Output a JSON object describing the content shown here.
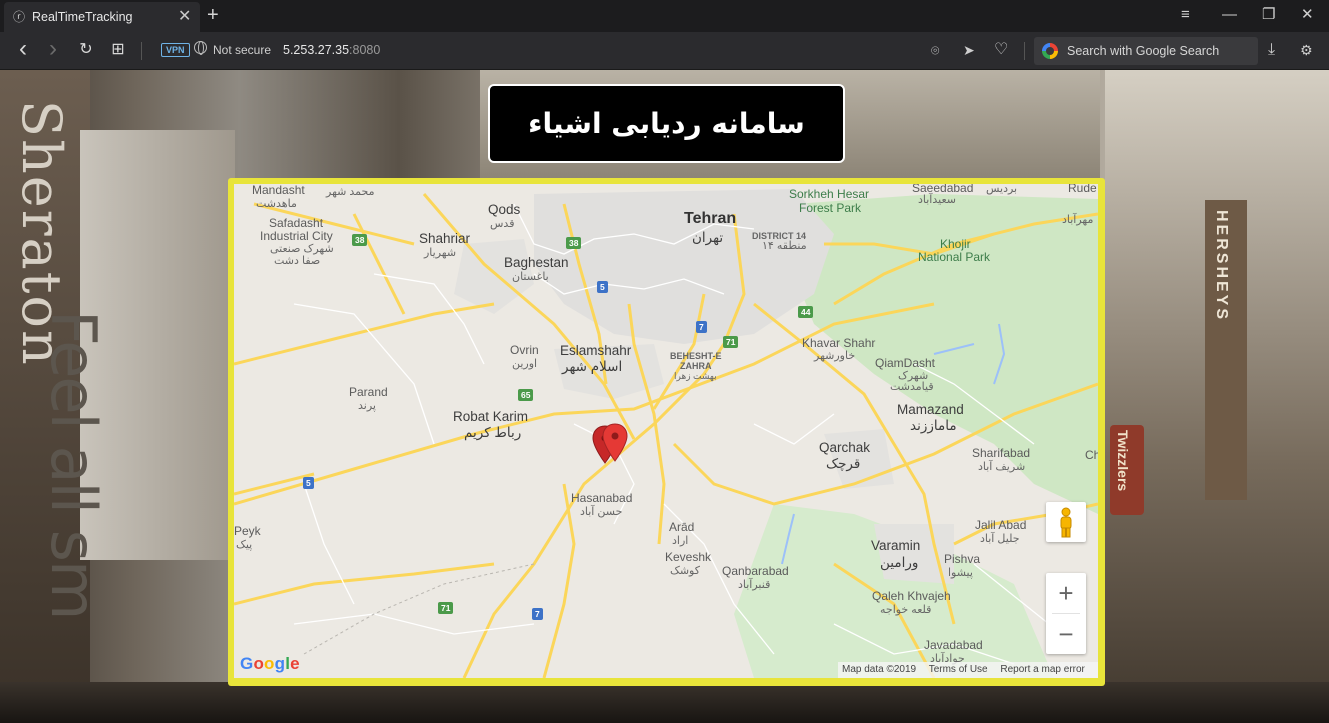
{
  "browser": {
    "tab_title": "RealTimeTracking",
    "tab_close": "✕",
    "new_tab": "+",
    "back_icon": "‹",
    "forward_icon": "›",
    "reload_icon": "↻",
    "grid_icon": "⊞",
    "vpn_label": "VPN",
    "security_label": "Not secure",
    "url_host": "5.253.27.35",
    "url_port": ":8080",
    "search_placeholder": "Search with Google Search",
    "window": {
      "menu": "≡",
      "minimize": "—",
      "restore": "❐",
      "close": "✕"
    },
    "tools": {
      "camera": "⌾",
      "send": "➤",
      "heart": "♡",
      "download": "⤓",
      "settings": "⚙"
    }
  },
  "page": {
    "title": "سامانه ردیابی اشیاء",
    "background_text": {
      "sheraton": "Sheraton",
      "truck": "Feel all sm",
      "hersheys": "HERSHEYS",
      "twizzlers": "Twizzlers"
    }
  },
  "map": {
    "labels": {
      "mandasht": "Mandasht",
      "mandasht_fa": "ماهدشت",
      "mohammadshahr_fa": "محمد شهر",
      "safadasht": "Safadasht",
      "industrial_city": "Industrial City",
      "safadasht_fa1": "شهرک صنعتی",
      "safadasht_fa2": "صفا دشت",
      "qods": "Qods",
      "qods_fa": "قدس",
      "shahriar": "Shahriar",
      "shahriar_fa": "شهریار",
      "baghestan": "Baghestan",
      "baghestan_fa": "باغستان",
      "tehran": "Tehran",
      "tehran_fa": "تهران",
      "district14": "DISTRICT 14",
      "district14_fa": "منطقه ۱۴",
      "sorkheh_hesar": "Sorkheh Hesar",
      "forest_park": "Forest Park",
      "saeedabad": "Saeedabad",
      "saeedabad_fa": "سعیدآباد",
      "bardis_fa": "بردیس",
      "rude": "Rude",
      "mehrabad_fa": "مهرآباد",
      "khojir": "Khojir",
      "national_park": "National Park",
      "ovrin": "Ovrin",
      "ovrin_fa": "اورین",
      "eslamshahr": "Eslamshahr",
      "eslamshahr_fa": "اسلام شهر",
      "beheshte_zahra": "BEHESHT-E",
      "beheshte_zahra2": "ZAHRA",
      "beheshte_zahra_fa": "بهشت زهرا",
      "khavar_shahr": "Khavar Shahr",
      "khavar_shahr_fa": "خاورشهر",
      "qiamdasht": "QiamDasht",
      "qiamdasht_fa1": "شهرک",
      "qiamdasht_fa2": "قیامدشت",
      "parand": "Parand",
      "parand_fa": "پرند",
      "robat_karim": "Robat Karim",
      "robat_karim_fa": "رباط کریم",
      "mamazand": "Mamazand",
      "mamazand_fa": "ماماززند",
      "qarchak": "Qarchak",
      "qarchak_fa": "قرچک",
      "sharifabad": "Sharifabad",
      "sharifabad_fa": "شریف آباد",
      "ch": "Ch",
      "hasanabad": "Hasanabad",
      "hasanabad_fa": "حسن آباد",
      "arad": "Arād",
      "arad_fa": "اراد",
      "keveshk": "Keveshk",
      "keveshk_fa": "کوشک",
      "peyk": "Peyk",
      "peyk_fa": "پیک",
      "jalil_abad": "Jalil Abad",
      "jalil_abad_fa": "جلیل آباد",
      "varamin": "Varamin",
      "varamin_fa": "ورامین",
      "qanbarabad": "Qanbarabad",
      "qanbarabad_fa": "قنبرآباد",
      "pishva": "Pishva",
      "pishva_fa": "پیشوا",
      "qaleh_khvajeh": "Qaleh Khvajeh",
      "qaleh_khvajeh_fa": "قلعه خواجه",
      "javadabad": "Javadabad",
      "javadabad_fa": "جوادآباد"
    },
    "road_shields": {
      "r38a": "38",
      "r38b": "38",
      "r5a": "5",
      "r5b": "5",
      "r7a": "7",
      "r7b": "7",
      "r71a": "71",
      "r71b": "71",
      "r44": "44",
      "r65": "65"
    },
    "zoom_in": "+",
    "zoom_out": "−",
    "google_logo": [
      "G",
      "o",
      "o",
      "g",
      "l",
      "e"
    ],
    "google_colors": [
      "#4285f4",
      "#ea4335",
      "#fbbc05",
      "#4285f4",
      "#34a853",
      "#ea4335"
    ],
    "footer": {
      "map_data": "Map data ©2019",
      "terms": "Terms of Use",
      "report": "Report a map error"
    },
    "frame_color": "#e8e43a",
    "marker_color": "#e53935"
  }
}
